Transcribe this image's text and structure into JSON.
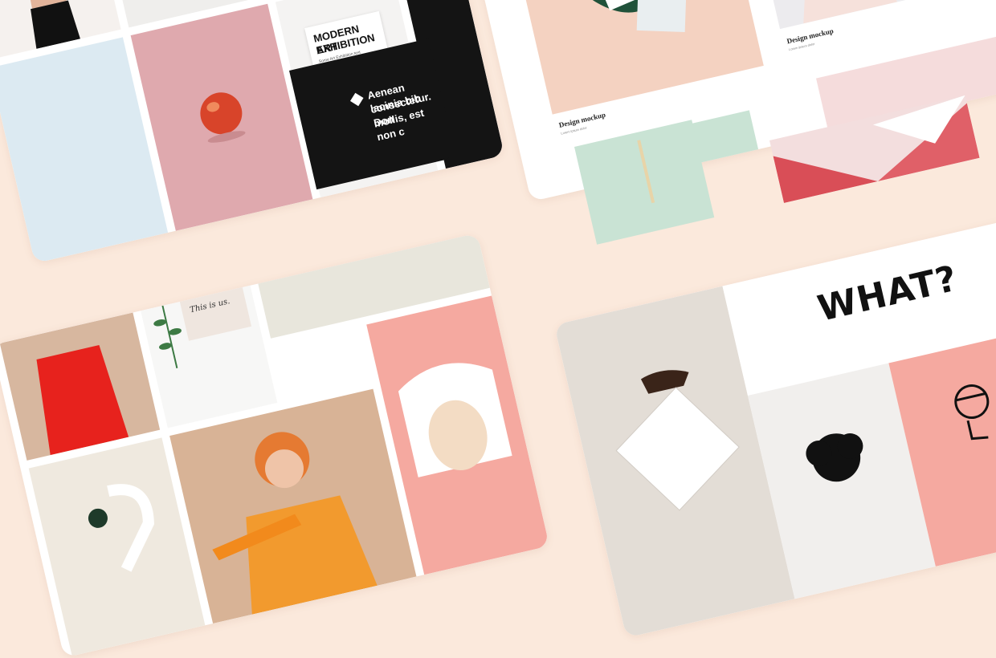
{
  "card_a": {
    "poster": {
      "title_line1": "MODERN ART",
      "title_line2": "EXHIBITION",
      "subtitle": "Some Art Exhibition text placeholder here"
    },
    "dark_tile": {
      "line1": "Aenean lacinia bib",
      "line2": "consectetur. Don",
      "line3": "mollis, est non c"
    }
  },
  "card_b": {
    "mockup_1": {
      "title": "Design mockup",
      "subtitle": "Lorem ipsum dolor"
    },
    "mockup_2": {
      "title": "Design mockup",
      "subtitle": "Lorem ipsum dolor"
    }
  },
  "card_c": {
    "note_text": "This is us."
  },
  "card_d": {
    "headline": "WHAT?"
  },
  "colors": {
    "background": "#fbe9dc",
    "peach_tile": "#dfa9ae",
    "blush_tile": "#f4d2c1",
    "mint_tile": "#c9e3d4",
    "coral_tile": "#f5a9a0",
    "dark_tile": "#141414"
  }
}
